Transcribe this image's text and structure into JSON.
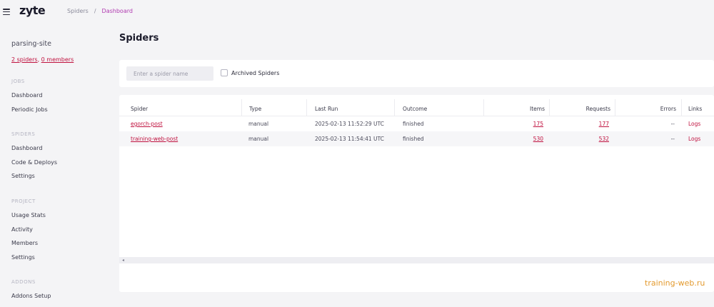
{
  "header": {
    "logo": "zyte",
    "breadcrumb": {
      "parent": "Spiders",
      "separator": "/",
      "current": "Dashboard"
    }
  },
  "sidebar": {
    "org_name": "parsing-site",
    "spiders_count": "2 spiders",
    "members_count": "0 members",
    "sections": {
      "jobs": {
        "title": "JOBS",
        "items": [
          "Dashboard",
          "Periodic Jobs"
        ]
      },
      "spiders": {
        "title": "SPIDERS",
        "items": [
          "Dashboard",
          "Code & Deploys",
          "Settings"
        ]
      },
      "project": {
        "title": "PROJECT",
        "items": [
          "Usage Stats",
          "Activity",
          "Members",
          "Settings"
        ]
      },
      "addons": {
        "title": "ADDONS",
        "items": [
          "Addons Setup"
        ]
      }
    }
  },
  "main": {
    "title": "Spiders",
    "search_placeholder": "Enter a spider name",
    "archived_label": "Archived Spiders",
    "columns": [
      "Spider",
      "Type",
      "Last Run",
      "Outcome",
      "Items",
      "Requests",
      "Errors",
      "Links"
    ],
    "rows": [
      {
        "spider": "egorch-post",
        "type": "manual",
        "last_run": "2025-02-13 11:52:29 UTC",
        "outcome": "finished",
        "items": "175",
        "requests": "177",
        "errors": "--",
        "links": "Logs"
      },
      {
        "spider": "training-web-post",
        "type": "manual",
        "last_run": "2025-02-13 11:54:41 UTC",
        "outcome": "finished",
        "items": "530",
        "requests": "532",
        "errors": "--",
        "links": "Logs"
      }
    ],
    "scroll_arrow": "◂"
  },
  "watermark": "training-web.ru",
  "colors": {
    "accent": "#c0123f",
    "breadcrumb_active": "#b03ab0",
    "watermark": "#e39a2e"
  }
}
